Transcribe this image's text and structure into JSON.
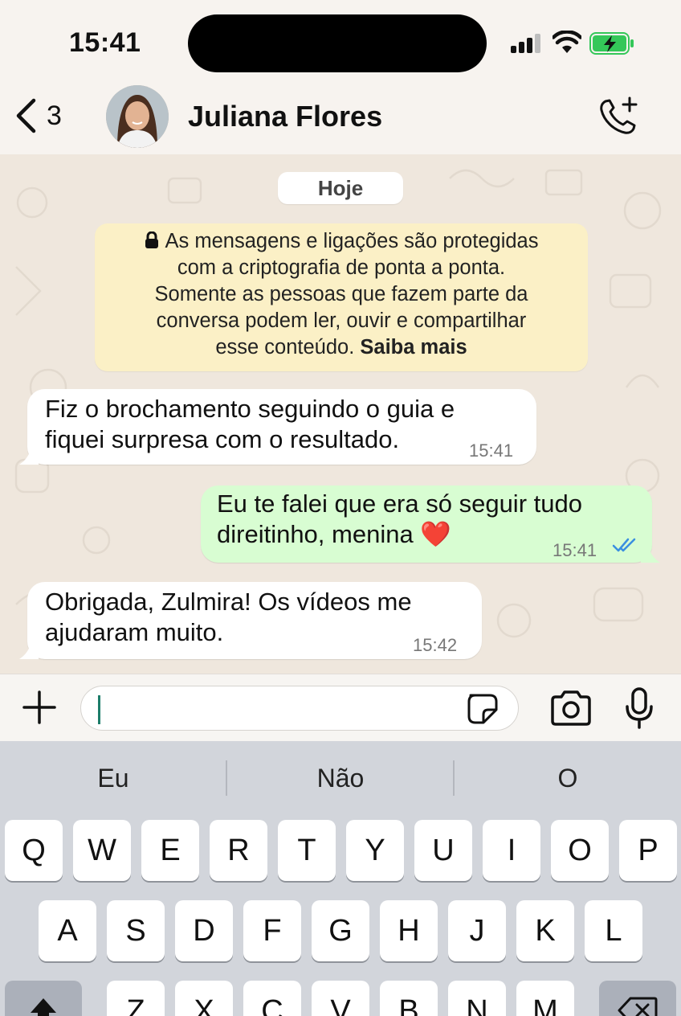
{
  "status": {
    "time": "15:41"
  },
  "header": {
    "back_count": "3",
    "contact_name": "Juliana Flores"
  },
  "chat": {
    "date_label": "Hoje",
    "encryption_notice": {
      "line1": "As mensagens e ligações são protegidas",
      "line2": "com a criptografia de ponta a ponta.",
      "line3": "Somente as pessoas que fazem parte da",
      "line4": "conversa podem ler, ouvir e compartilhar",
      "line5": "esse conteúdo.",
      "link": "Saiba mais"
    },
    "messages": [
      {
        "direction": "in",
        "line1": "Fiz o brochamento seguindo o guia e",
        "line2": "fiquei surpresa com o resultado.",
        "time": "15:41"
      },
      {
        "direction": "out",
        "line1": "Eu te falei que era só seguir tudo",
        "line2": "direitinho, menina ❤️",
        "time": "15:41",
        "read": true
      },
      {
        "direction": "in",
        "line1": "Obrigada, Zulmira! Os vídeos me",
        "line2": "ajudaram muito.",
        "time": "15:42"
      }
    ]
  },
  "input": {
    "value": "",
    "placeholder": ""
  },
  "keyboard": {
    "suggestions": [
      "Eu",
      "Não",
      "O"
    ],
    "row1": [
      "Q",
      "W",
      "E",
      "R",
      "T",
      "Y",
      "U",
      "I",
      "O",
      "P"
    ],
    "row2": [
      "A",
      "S",
      "D",
      "F",
      "G",
      "H",
      "J",
      "K",
      "L"
    ],
    "row3": [
      "Z",
      "X",
      "C",
      "V",
      "B",
      "N",
      "M"
    ]
  },
  "icons": {
    "back": "chevron-left-icon",
    "call_add": "phone-plus-icon",
    "lock": "lock-icon",
    "read_receipt": "double-check-icon",
    "plus": "plus-icon",
    "sticker": "sticker-icon",
    "camera": "camera-icon",
    "mic": "microphone-icon",
    "shift": "shift-icon",
    "backspace": "backspace-icon"
  },
  "colors": {
    "outgoing_bubble": "#d8fdd2",
    "incoming_bubble": "#ffffff",
    "notice_bg": "#fbf0c6",
    "read_tick": "#3a8fe0",
    "battery": "#34c759"
  }
}
